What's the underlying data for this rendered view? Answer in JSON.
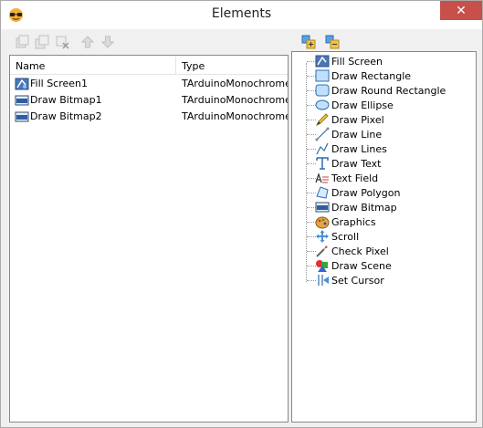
{
  "window": {
    "title": "Elements",
    "close_glyph": "✕"
  },
  "toolbar": {
    "left_icons": [
      "add-element-icon",
      "duplicate-element-icon",
      "delete-element-icon",
      "move-up-icon",
      "move-down-icon"
    ],
    "right_icons": [
      "expand-tree-icon",
      "collapse-tree-icon"
    ]
  },
  "list": {
    "columns": {
      "name": "Name",
      "type": "Type"
    },
    "rows": [
      {
        "name": "Fill Screen1",
        "type": "TArduinoMonochromeDisplayElementFillScreen",
        "icon": "fill-screen-icon"
      },
      {
        "name": "Draw Bitmap1",
        "type": "TArduinoMonochromeDisplayElementDrawBitmap",
        "icon": "draw-bitmap-icon"
      },
      {
        "name": "Draw Bitmap2",
        "type": "TArduinoMonochromeDisplayElementDrawBitmap",
        "icon": "draw-bitmap-icon"
      }
    ]
  },
  "palette": {
    "items": [
      {
        "label": "Fill Screen",
        "icon": "fill-screen-icon"
      },
      {
        "label": "Draw Rectangle",
        "icon": "rectangle-icon"
      },
      {
        "label": "Draw Round Rectangle",
        "icon": "round-rectangle-icon"
      },
      {
        "label": "Draw Ellipse",
        "icon": "ellipse-icon"
      },
      {
        "label": "Draw Pixel",
        "icon": "pencil-icon"
      },
      {
        "label": "Draw Line",
        "icon": "line-icon"
      },
      {
        "label": "Draw Lines",
        "icon": "lines-icon"
      },
      {
        "label": "Draw Text",
        "icon": "text-icon"
      },
      {
        "label": "Text Field",
        "icon": "text-field-icon"
      },
      {
        "label": "Draw Polygon",
        "icon": "polygon-icon"
      },
      {
        "label": "Draw Bitmap",
        "icon": "draw-bitmap-icon"
      },
      {
        "label": "Graphics",
        "icon": "graphics-icon"
      },
      {
        "label": "Scroll",
        "icon": "scroll-icon"
      },
      {
        "label": "Check Pixel",
        "icon": "check-pixel-icon"
      },
      {
        "label": "Draw Scene",
        "icon": "scene-icon"
      },
      {
        "label": "Set Cursor",
        "icon": "cursor-icon"
      }
    ]
  }
}
